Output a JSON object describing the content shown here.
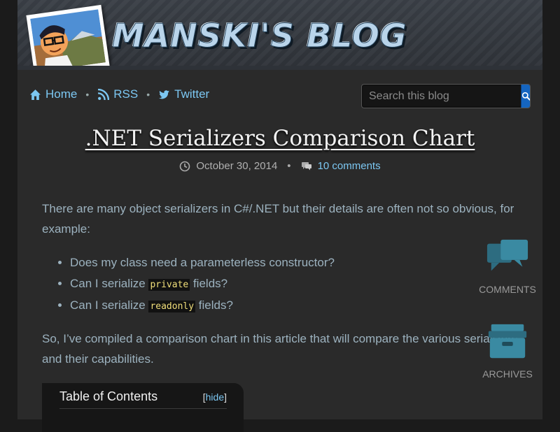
{
  "site": {
    "title": "MANSKI'S BLOG"
  },
  "nav": {
    "home": "Home",
    "rss": "RSS",
    "twitter": "Twitter",
    "separator": "•"
  },
  "search": {
    "placeholder": "Search this blog"
  },
  "post": {
    "title": ".NET Serializers Comparison Chart",
    "date": "October 30, 2014",
    "comments": "10 comments",
    "intro": "There are many object serializers in C#/.NET but their details are often not so obvious, for example:",
    "bullets": {
      "b1": "Does my class need a parameterless constructor?",
      "b2_pre": "Can I serialize ",
      "b2_code": "private",
      "b2_post": " fields?",
      "b3_pre": "Can I serialize ",
      "b3_code": "readonly",
      "b3_post": " fields?"
    },
    "outro": "So, I’ve compiled a comparison chart in this article that will compare the various serializers and their capabilities."
  },
  "toc": {
    "title": "Table of Contents",
    "hide_open": "[",
    "hide_label": "hide",
    "hide_close": "]"
  },
  "side": {
    "comments": "COMMENTS",
    "archives": "ARCHIVES"
  },
  "colors": {
    "link": "#7cc7f2",
    "accent": "#1565c0",
    "side_icon": "#2d6c80"
  }
}
